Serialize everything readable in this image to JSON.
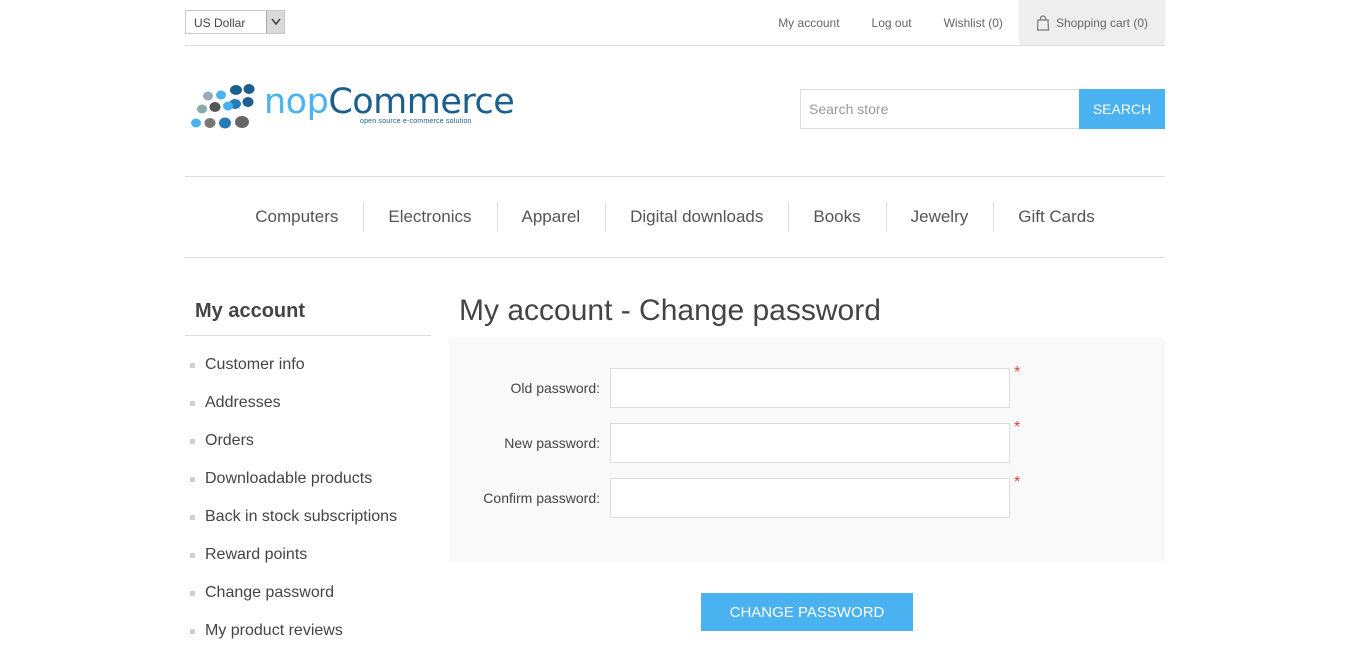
{
  "header": {
    "currency": "US Dollar",
    "links": {
      "my_account": "My account",
      "log_out": "Log out",
      "wishlist": "Wishlist (0)",
      "shopping_cart": "Shopping cart (0)"
    }
  },
  "logo": {
    "brand_nop": "nop",
    "brand_commerce": "Commerce",
    "tagline": "open source e-commerce solution"
  },
  "search": {
    "placeholder": "Search store",
    "button": "SEARCH"
  },
  "menu": [
    "Computers",
    "Electronics",
    "Apparel",
    "Digital downloads",
    "Books",
    "Jewelry",
    "Gift Cards"
  ],
  "sidebar": {
    "title": "My account",
    "items": [
      "Customer info",
      "Addresses",
      "Orders",
      "Downloadable products",
      "Back in stock subscriptions",
      "Reward points",
      "Change password",
      "My product reviews"
    ]
  },
  "main": {
    "title": "My account - Change password",
    "fields": {
      "old_password": {
        "label": "Old password:",
        "value": ""
      },
      "new_password": {
        "label": "New password:",
        "value": ""
      },
      "confirm_password": {
        "label": "Confirm password:",
        "value": ""
      }
    },
    "required_mark": "*",
    "submit": "CHANGE PASSWORD"
  },
  "colors": {
    "accent": "#4ab2f1",
    "required": "#e4434b",
    "brand_dark": "#1b5f8f"
  }
}
